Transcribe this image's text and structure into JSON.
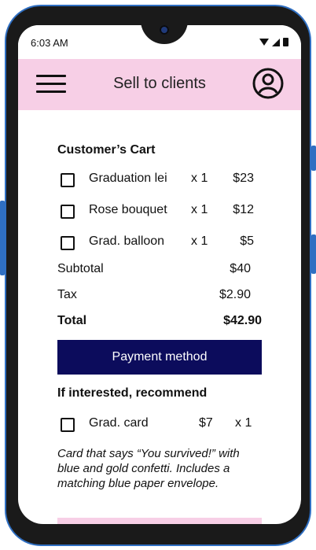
{
  "status_bar": {
    "time": "6:03 AM",
    "icons": [
      "wifi-icon",
      "signal-icon",
      "battery-icon"
    ]
  },
  "app_bar": {
    "title": "Sell to clients",
    "menu_icon": "hamburger-icon",
    "account_icon": "account-icon"
  },
  "cart": {
    "title": "Customer’s Cart",
    "items": [
      {
        "name": "Graduation lei",
        "qty": "x 1",
        "price": "$23",
        "checked": false
      },
      {
        "name": "Rose bouquet",
        "qty": "x 1",
        "price": "$12",
        "checked": false
      },
      {
        "name": "Grad. balloon",
        "qty": "x 1",
        "price": "$5",
        "checked": false
      }
    ],
    "subtotal_label": "Subtotal",
    "subtotal_value": "$40",
    "tax_label": "Tax",
    "tax_value": "$2.90",
    "total_label": "Total",
    "total_value": "$42.90"
  },
  "payment_button_label": "Payment method",
  "recommend": {
    "title": "If interested, recommend",
    "item": {
      "name": "Grad. card",
      "price": "$7",
      "qty": "x 1",
      "checked": false
    },
    "description": "Card that says “You survived!” with blue and gold confetti. Includes a matching blue paper envelope."
  },
  "colors": {
    "app_bar": "#f7cfe6",
    "primary_button": "#0c0c5c",
    "phone_frame": "#1a1a1a",
    "phone_accent": "#2f6fc2"
  }
}
